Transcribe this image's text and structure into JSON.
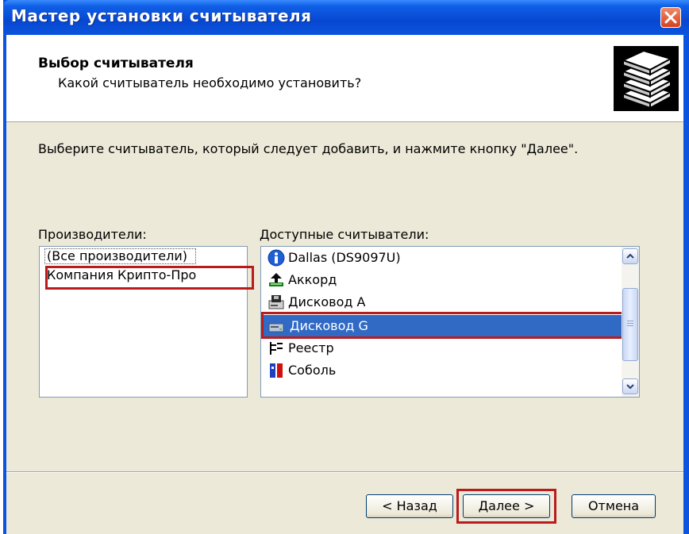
{
  "window": {
    "title": "Мастер установки считывателя"
  },
  "header": {
    "title": "Выбор считывателя",
    "subtitle": "Какой считыватель необходимо установить?"
  },
  "instruction": "Выберите считыватель, который следует добавить, и нажмите кнопку \"Далее\".",
  "manufacturers": {
    "label": "Производители:",
    "items": [
      "(Все производители)",
      "Компания Крипто-Про"
    ],
    "highlighted": "Компания Крипто-Про"
  },
  "readers": {
    "label": "Доступные считыватели:",
    "items": [
      {
        "label": "Dallas (DS9097U)",
        "icon": "info-icon"
      },
      {
        "label": "Аккорд",
        "icon": "accord-icon"
      },
      {
        "label": "Дисковод А",
        "icon": "floppy-drive-icon"
      },
      {
        "label": "Дисковод G",
        "icon": "removable-drive-icon"
      },
      {
        "label": "Реестр",
        "icon": "registry-icon"
      },
      {
        "label": "Соболь",
        "icon": "sobol-icon"
      }
    ],
    "selected": "Дисковод G"
  },
  "buttons": {
    "back": "< Назад",
    "next": "Далее >",
    "cancel": "Отмена"
  },
  "colors": {
    "titlebar": "#0a54e0",
    "selection": "#316ac5",
    "highlight_box": "#b91c1c",
    "dialog_bg": "#ece9d8"
  }
}
